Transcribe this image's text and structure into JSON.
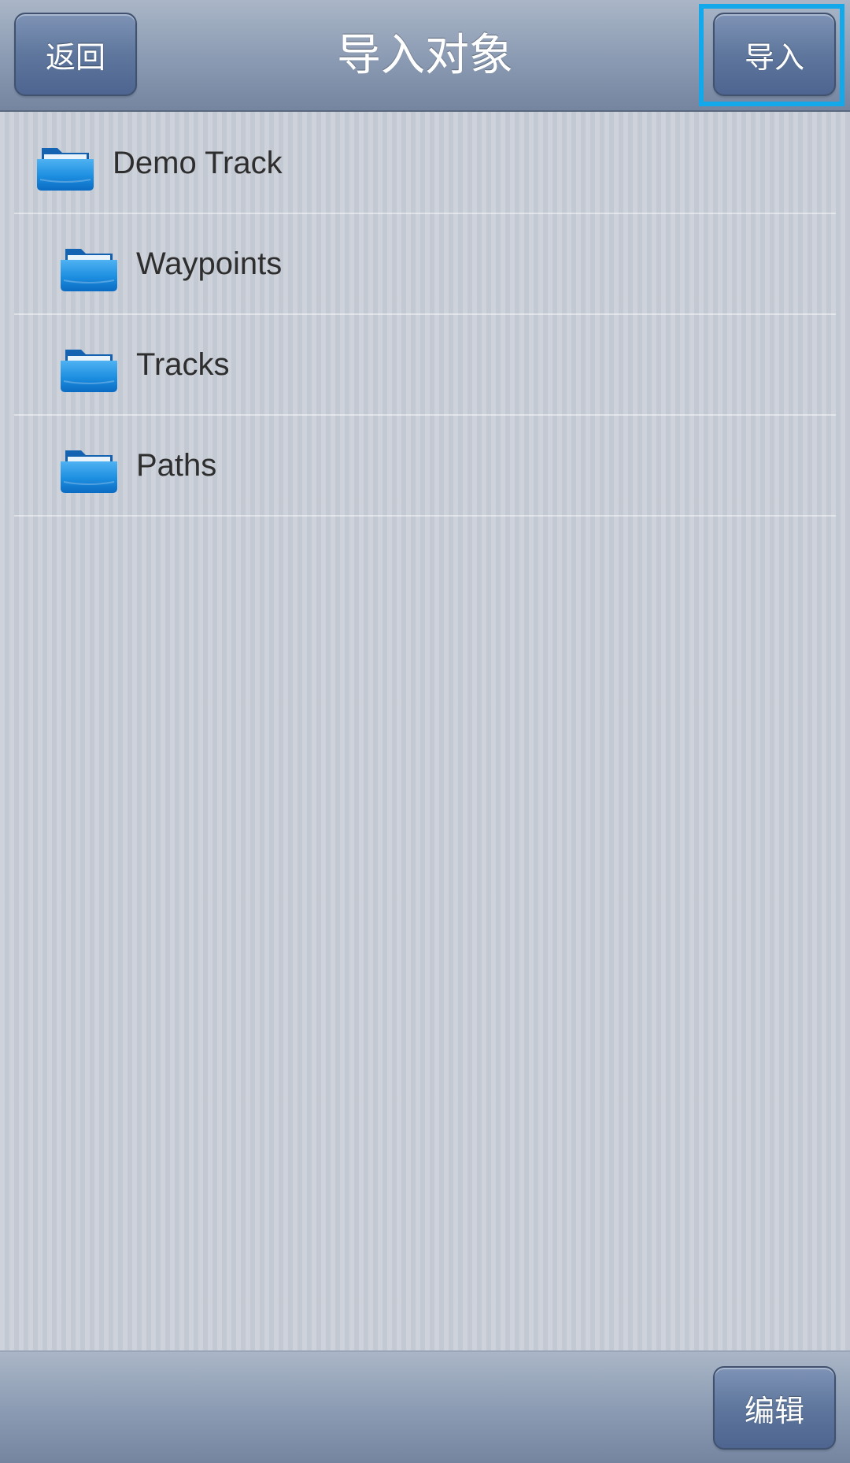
{
  "header": {
    "title": "导入对象",
    "back_label": "返回",
    "import_label": "导入"
  },
  "folders": [
    {
      "label": "Demo Track",
      "level": 0,
      "icon": "folder-icon"
    },
    {
      "label": "Waypoints",
      "level": 1,
      "icon": "folder-icon"
    },
    {
      "label": "Tracks",
      "level": 1,
      "icon": "folder-icon"
    },
    {
      "label": "Paths",
      "level": 1,
      "icon": "folder-icon"
    }
  ],
  "footer": {
    "edit_label": "编辑"
  },
  "colors": {
    "highlight": "#12a8e9",
    "folder": "#1f8fe0",
    "button": "#5f779d"
  }
}
